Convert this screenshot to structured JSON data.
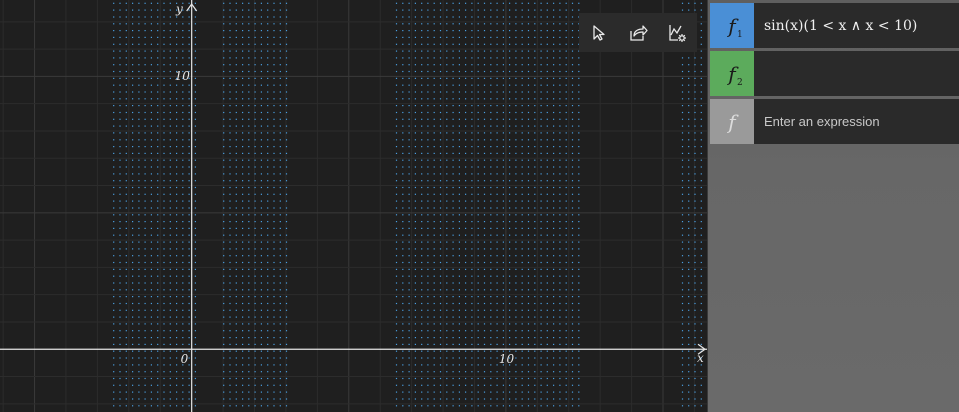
{
  "colors": {
    "background": "#1f1f1f",
    "grid_minor": "#2c2c2c",
    "grid_major": "#3a3a3a",
    "axis": "#e6e6e6",
    "plot_points": "#4a9ee0",
    "f1_swatch": "#4a8fd6",
    "f2_swatch": "#5cab5c",
    "f3_swatch": "#9a9a9a"
  },
  "axes": {
    "x_label": "x",
    "y_label": "y",
    "x_ticks": [
      {
        "value": 0,
        "label": "0"
      },
      {
        "value": 10,
        "label": "10"
      }
    ],
    "y_ticks": [
      {
        "value": 10,
        "label": "10"
      }
    ],
    "x_range": [
      -6.1,
      16.4
    ],
    "y_range": [
      -2.3,
      12.8
    ]
  },
  "toolbar": {
    "select_icon": "cursor-icon",
    "share_icon": "share-icon",
    "settings_icon": "graph-settings-icon"
  },
  "functions": [
    {
      "letter": "f",
      "subscript": "1",
      "expression": "sin(x)(1 < x ∧ x < 10)",
      "placeholder": ""
    },
    {
      "letter": "f",
      "subscript": "2",
      "expression": "",
      "placeholder": ""
    },
    {
      "letter": "f",
      "subscript": "",
      "expression": "",
      "placeholder": "Enter an expression"
    }
  ],
  "chart_data": {
    "type": "scatter",
    "x_column_ranges": [
      [
        -2.5,
        0.1
      ],
      [
        1.0,
        3.1
      ],
      [
        6.5,
        12.4
      ],
      [
        15.6,
        16.2
      ]
    ],
    "x_column_step": 0.2,
    "y_range": [
      -2.3,
      12.8
    ],
    "y_row_step": 0.25
  }
}
